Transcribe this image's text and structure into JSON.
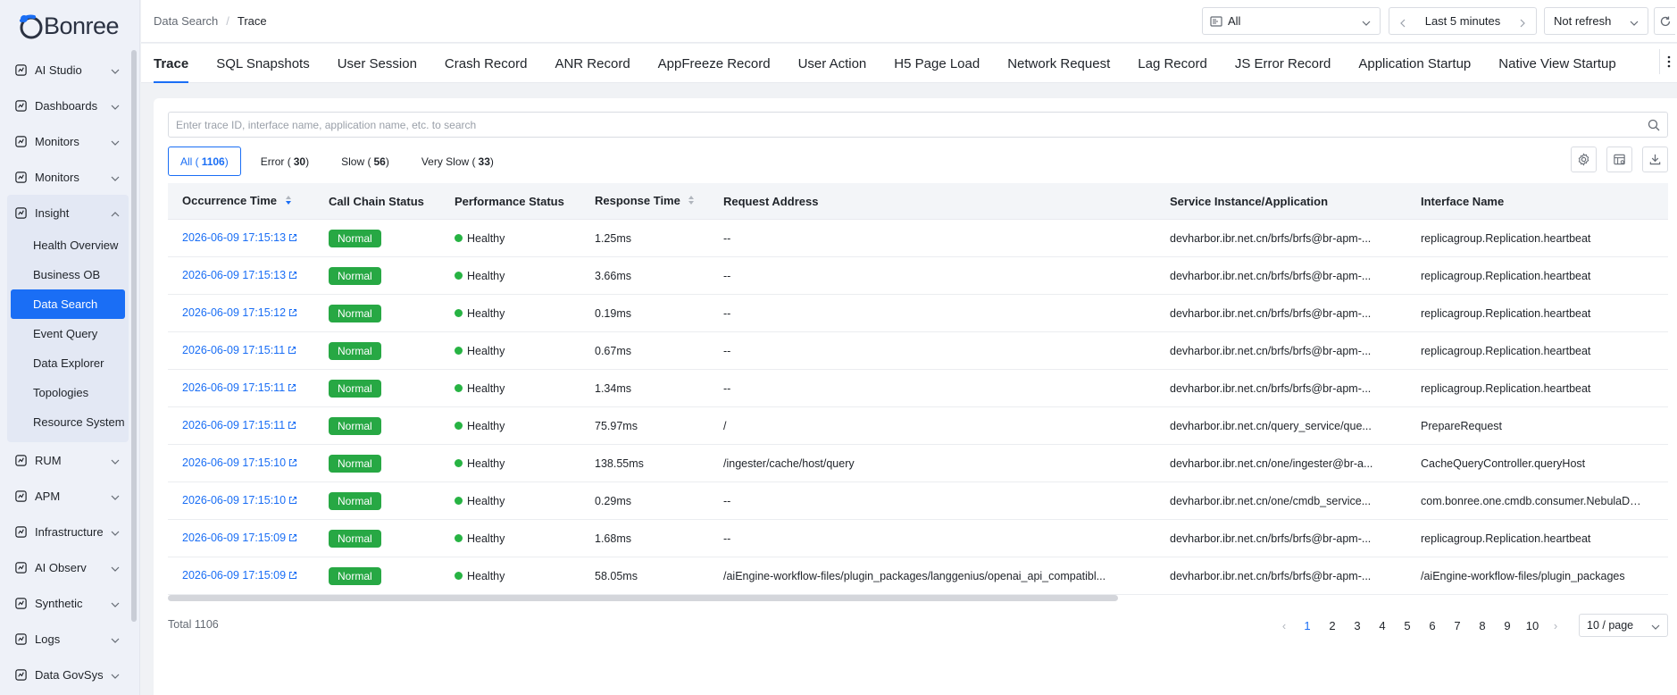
{
  "app": {
    "logo_text": "Bonree"
  },
  "sidebar": {
    "items": [
      {
        "label": "AI Studio",
        "icon": "ai-studio-icon"
      },
      {
        "label": "Dashboards",
        "icon": "dashboard-icon"
      },
      {
        "label": "Monitors",
        "icon": "monitor-icon"
      },
      {
        "label": "Monitors",
        "icon": "monitor-icon"
      }
    ],
    "insight": {
      "label": "Insight",
      "icon": "insight-icon",
      "children": [
        "Health Overview",
        "Business OB",
        "Data Search",
        "Event Query",
        "Data Explorer",
        "Topologies",
        "Resource System"
      ],
      "active": "Data Search"
    },
    "items_after": [
      {
        "label": "RUM",
        "icon": "rum-icon"
      },
      {
        "label": "APM",
        "icon": "apm-icon"
      },
      {
        "label": "Infrastructure",
        "icon": "infrastructure-icon"
      },
      {
        "label": "AI Observ",
        "icon": "ai-observ-icon"
      },
      {
        "label": "Synthetic",
        "icon": "synthetic-icon"
      },
      {
        "label": "Logs",
        "icon": "logs-icon"
      },
      {
        "label": "Data GovSys",
        "icon": "data-govsys-icon"
      }
    ]
  },
  "header": {
    "breadcrumb": [
      "Data Search",
      "Trace"
    ],
    "app_select": "All",
    "time_range": "Last 5 minutes",
    "refresh": "Not refresh"
  },
  "tabs": [
    "Trace",
    "SQL Snapshots",
    "User Session",
    "Crash Record",
    "ANR Record",
    "AppFreeze Record",
    "User Action",
    "H5 Page Load",
    "Network Request",
    "Lag Record",
    "JS Error Record",
    "Application Startup",
    "Native View Startup"
  ],
  "search": {
    "placeholder": "Enter trace ID, interface name, application name, etc. to search"
  },
  "filters": [
    {
      "label": "All",
      "count": "1106"
    },
    {
      "label": "Error",
      "count": "30"
    },
    {
      "label": "Slow",
      "count": "56"
    },
    {
      "label": "Very Slow",
      "count": "33"
    }
  ],
  "table": {
    "columns": [
      "Occurrence Time",
      "Call Chain Status",
      "Performance Status",
      "Response Time",
      "Request Address",
      "Service Instance/Application",
      "Interface Name"
    ],
    "rows": [
      [
        "2026-06-09 17:15:13",
        "Normal",
        "Healthy",
        "1.25ms",
        "--",
        "devharbor.ibr.net.cn/brfs/brfs@br-apm-...",
        "replicagroup.Replication.heartbeat"
      ],
      [
        "2026-06-09 17:15:13",
        "Normal",
        "Healthy",
        "3.66ms",
        "--",
        "devharbor.ibr.net.cn/brfs/brfs@br-apm-...",
        "replicagroup.Replication.heartbeat"
      ],
      [
        "2026-06-09 17:15:12",
        "Normal",
        "Healthy",
        "0.19ms",
        "--",
        "devharbor.ibr.net.cn/brfs/brfs@br-apm-...",
        "replicagroup.Replication.heartbeat"
      ],
      [
        "2026-06-09 17:15:11",
        "Normal",
        "Healthy",
        "0.67ms",
        "--",
        "devharbor.ibr.net.cn/brfs/brfs@br-apm-...",
        "replicagroup.Replication.heartbeat"
      ],
      [
        "2026-06-09 17:15:11",
        "Normal",
        "Healthy",
        "1.34ms",
        "--",
        "devharbor.ibr.net.cn/brfs/brfs@br-apm-...",
        "replicagroup.Replication.heartbeat"
      ],
      [
        "2026-06-09 17:15:11",
        "Normal",
        "Healthy",
        "75.97ms",
        "/",
        "devharbor.ibr.net.cn/query_service/que...",
        "PrepareRequest"
      ],
      [
        "2026-06-09 17:15:10",
        "Normal",
        "Healthy",
        "138.55ms",
        "/ingester/cache/host/query",
        "devharbor.ibr.net.cn/one/ingester@br-a...",
        "CacheQueryController.queryHost"
      ],
      [
        "2026-06-09 17:15:10",
        "Normal",
        "Healthy",
        "0.29ms",
        "--",
        "devharbor.ibr.net.cn/one/cmdb_service...",
        "com.bonree.one.cmdb.consumer.NebulaData"
      ],
      [
        "2026-06-09 17:15:09",
        "Normal",
        "Healthy",
        "1.68ms",
        "--",
        "devharbor.ibr.net.cn/brfs/brfs@br-apm-...",
        "replicagroup.Replication.heartbeat"
      ],
      [
        "2026-06-09 17:15:09",
        "Normal",
        "Healthy",
        "58.05ms",
        "/aiEngine-workflow-files/plugin_packages/langgenius/openai_api_compatibl...",
        "devharbor.ibr.net.cn/brfs/brfs@br-apm-...",
        "/aiEngine-workflow-files/plugin_packages"
      ]
    ]
  },
  "footer": {
    "total": "Total 1106",
    "pages": [
      "1",
      "2",
      "3",
      "4",
      "5",
      "6",
      "7",
      "8",
      "9",
      "10"
    ],
    "current_page": "1",
    "page_size": "10 / page"
  },
  "colors": {
    "accent": "#1a6ef5",
    "normal_badge": "#27a844",
    "healthy_dot": "#27b343"
  }
}
